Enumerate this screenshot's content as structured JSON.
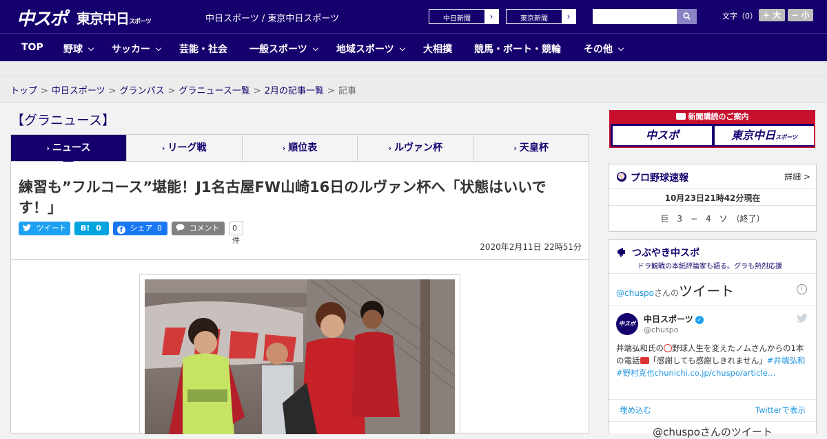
{
  "header": {
    "logo_primary": "中スポ",
    "logo_secondary": "東京中日",
    "logo_secondary_small": "スポーツ",
    "site_title": "中日スポーツ / 東京中日スポーツ",
    "link_chunichi": "中日新聞",
    "link_tokyo": "東京新聞",
    "fontsize_label": "文字（0）",
    "font_larger": "+ 大",
    "font_smaller": "− 小"
  },
  "nav": {
    "items": [
      "TOP",
      "野球",
      "サッカー",
      "芸能・社会",
      "一般スポーツ",
      "地域スポーツ",
      "大相撲",
      "競馬・ボート・競輪",
      "その他"
    ]
  },
  "breadcrumb": {
    "items": [
      "トップ",
      "中日スポーツ",
      "グランパス",
      "グラニュース一覧",
      "2月の記事一覧"
    ],
    "current": "記事",
    "separator": ">"
  },
  "section_title": "【グラニュース】",
  "tabs": [
    "ニュース",
    "リーグ戦",
    "順位表",
    "ルヴァン杯",
    "天皇杯"
  ],
  "tab_marker": "›",
  "article": {
    "headline": "練習も”フルコース”堪能！J1名古屋FW山崎16日のルヴァン杯へ「状態はいいです！」",
    "tweet_label": "ツイート",
    "hatena_label": "B!",
    "hatena_count": "0",
    "facebook_label": "シェア",
    "facebook_count": "0",
    "comment_label": "コメント",
    "comment_count": "0件",
    "date": "2020年2月11日 22時51分"
  },
  "sidebar": {
    "ad_title": "新聞購読のご案内",
    "ad_left": "中スポ",
    "ad_right": "東京中日",
    "ad_right_small": "スポーツ",
    "baseball": {
      "title": "プロ野球速報",
      "detail": "詳細 >",
      "timestamp": "10月23日21時42分現在",
      "score": "巨　3　−　4　ソ　（終了）"
    },
    "tweets": {
      "title": "つぶやき中スポ",
      "subtitle": "ドラ観戦の本紙評論家も語る。グラも熱烈応援",
      "handle_prefix": "@chuspo",
      "handle_suffix": "さんの",
      "heading": "ツイート",
      "account_name": "中日スポーツ",
      "account_handle": "@chuspo",
      "avatar_text": "中スポ",
      "tweet_text": "井端弘和氏の",
      "tweet_text_2": "野球人生を変えたノムさんからの1本の電話",
      "tweet_text_3": "「感謝しても感謝しきれません」",
      "tweet_tag_1": "#井端弘和",
      "tweet_tag_2": "#野村克也",
      "tweet_link": "chunichi.co.jp/chuspo/article…",
      "embed_label": "埋め込む",
      "view_on_twitter": "Twitterで表示",
      "footer_text": "@chuspoさんのツイート"
    }
  },
  "colors": {
    "brand_navy": "#16006e",
    "accent_red": "#c8102e",
    "twitter_blue": "#1da1f2",
    "facebook_blue": "#1877f2",
    "hatena_blue": "#00a4de",
    "comment_gray": "#808080"
  }
}
